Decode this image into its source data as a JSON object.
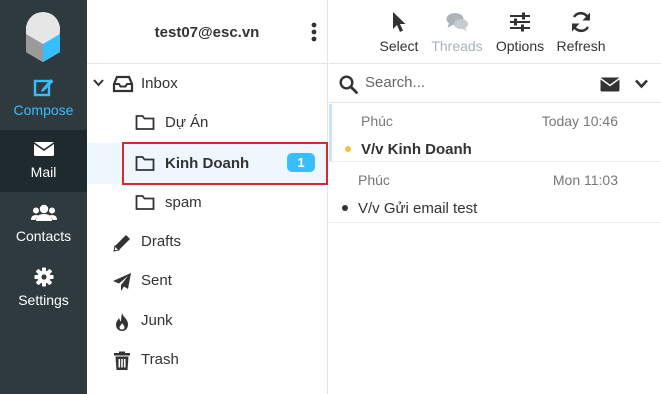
{
  "nav": {
    "compose": "Compose",
    "mail": "Mail",
    "contacts": "Contacts",
    "settings": "Settings"
  },
  "account": {
    "email": "test07@esc.vn"
  },
  "folders": [
    {
      "label": "Inbox"
    },
    {
      "label": "Dự Án"
    },
    {
      "label": "Kinh Doanh",
      "unread": "1"
    },
    {
      "label": "spam"
    },
    {
      "label": "Drafts"
    },
    {
      "label": "Sent"
    },
    {
      "label": "Junk"
    },
    {
      "label": "Trash"
    }
  ],
  "toolbar": {
    "select": "Select",
    "threads": "Threads",
    "options": "Options",
    "refresh": "Refresh"
  },
  "search": {
    "placeholder": "Search..."
  },
  "messages": [
    {
      "from": "Phúc",
      "date": "Today 10:46",
      "subject": "V/v Kinh Doanh",
      "unread": true
    },
    {
      "from": "Phúc",
      "date": "Mon 11:03",
      "subject": "V/v Gửi email test",
      "unread": false
    }
  ],
  "colors": {
    "accent": "#37beff",
    "nav_bg": "#2f3a3f",
    "highlight": "#d9272e",
    "unread_dot": "#f5c33b"
  }
}
